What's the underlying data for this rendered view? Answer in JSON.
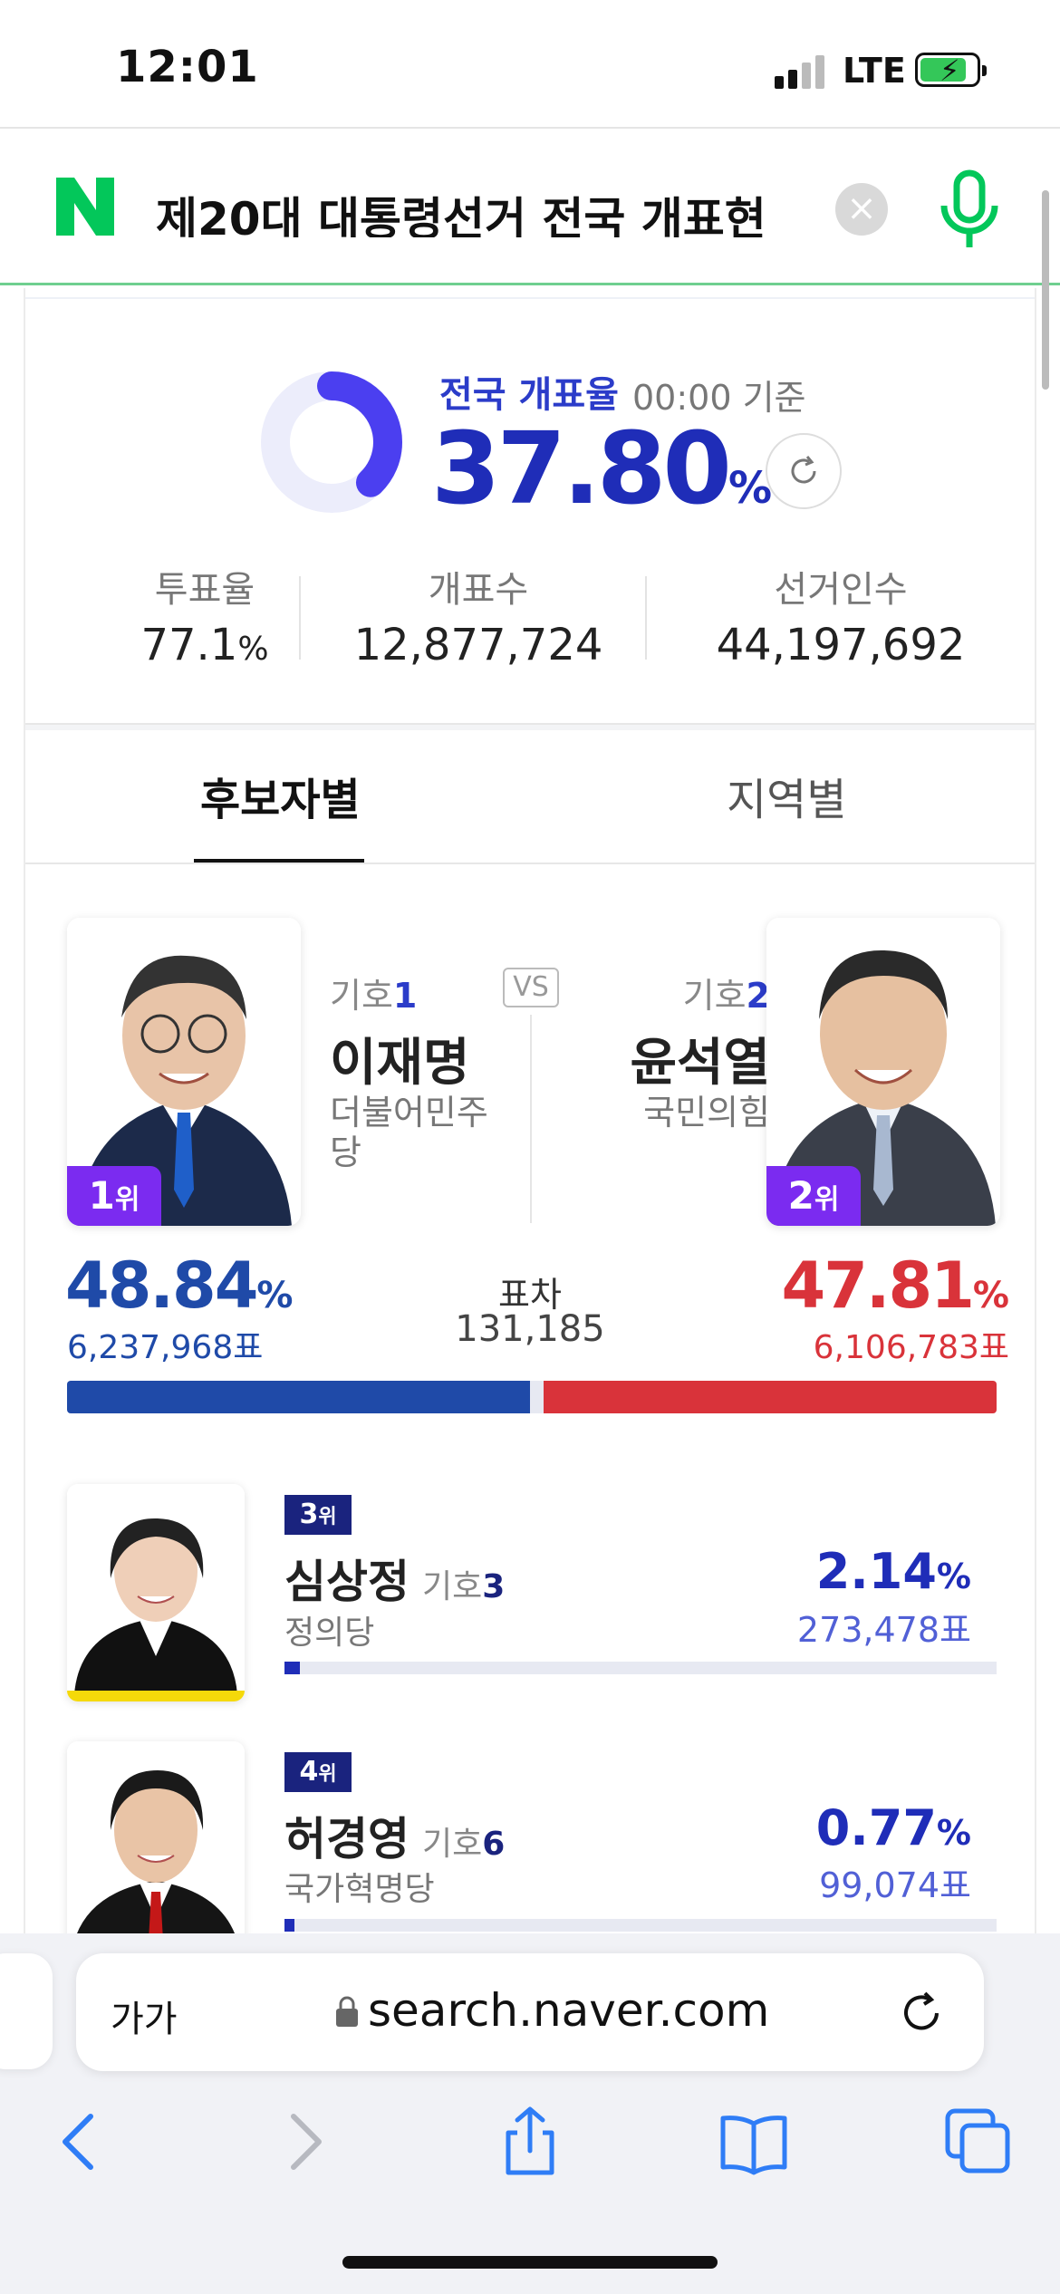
{
  "status_bar": {
    "time": "12:01",
    "network": "LTE"
  },
  "search": {
    "logo": "N",
    "query": "제20대 대통령선거 전국 개표현",
    "clear": "×"
  },
  "counting": {
    "title": "전국 개표율",
    "as_of": "00:00 기준",
    "rate": "37.80",
    "rate_unit": "%",
    "rate_fraction": 0.378,
    "stats": [
      {
        "label": "투표율",
        "value": "77.1",
        "unit": "%"
      },
      {
        "label": "개표수",
        "value": "12,877,724",
        "unit": ""
      },
      {
        "label": "선거인수",
        "value": "44,197,692",
        "unit": ""
      }
    ]
  },
  "tabs": [
    {
      "label": "후보자별",
      "active": true
    },
    {
      "label": "지역별",
      "active": false
    }
  ],
  "head_to_head": {
    "left": {
      "rank": "1",
      "rank_unit": "위",
      "number_label": "기호",
      "number": "1",
      "name": "이재명",
      "party": "더불어민주당",
      "pct": "48.84",
      "votes": "6,237,968표",
      "color": "#1f4aa8"
    },
    "vs": "VS",
    "right": {
      "rank": "2",
      "rank_unit": "위",
      "number_label": "기호",
      "number": "2",
      "name": "윤석열",
      "party": "국민의힘",
      "pct": "47.81",
      "votes": "6,106,783표",
      "color": "#d9333a"
    },
    "gap_label": "표차",
    "gap_value": "131,185",
    "pct_unit": "%"
  },
  "others": [
    {
      "rank": "3",
      "rank_unit": "위",
      "name": "심상정",
      "number_label": "기호",
      "number": "3",
      "party": "정의당",
      "pct": "2.14",
      "votes": "273,478표",
      "share": 0.0214,
      "accent": "#f5d90a"
    },
    {
      "rank": "4",
      "rank_unit": "위",
      "name": "허경영",
      "number_label": "기호",
      "number": "6",
      "party": "국가혁명당",
      "pct": "0.77",
      "votes": "99,074표",
      "share": 0.0077,
      "accent": "#ffffff"
    }
  ],
  "browser": {
    "aa": "가가",
    "url": "search.naver.com"
  }
}
